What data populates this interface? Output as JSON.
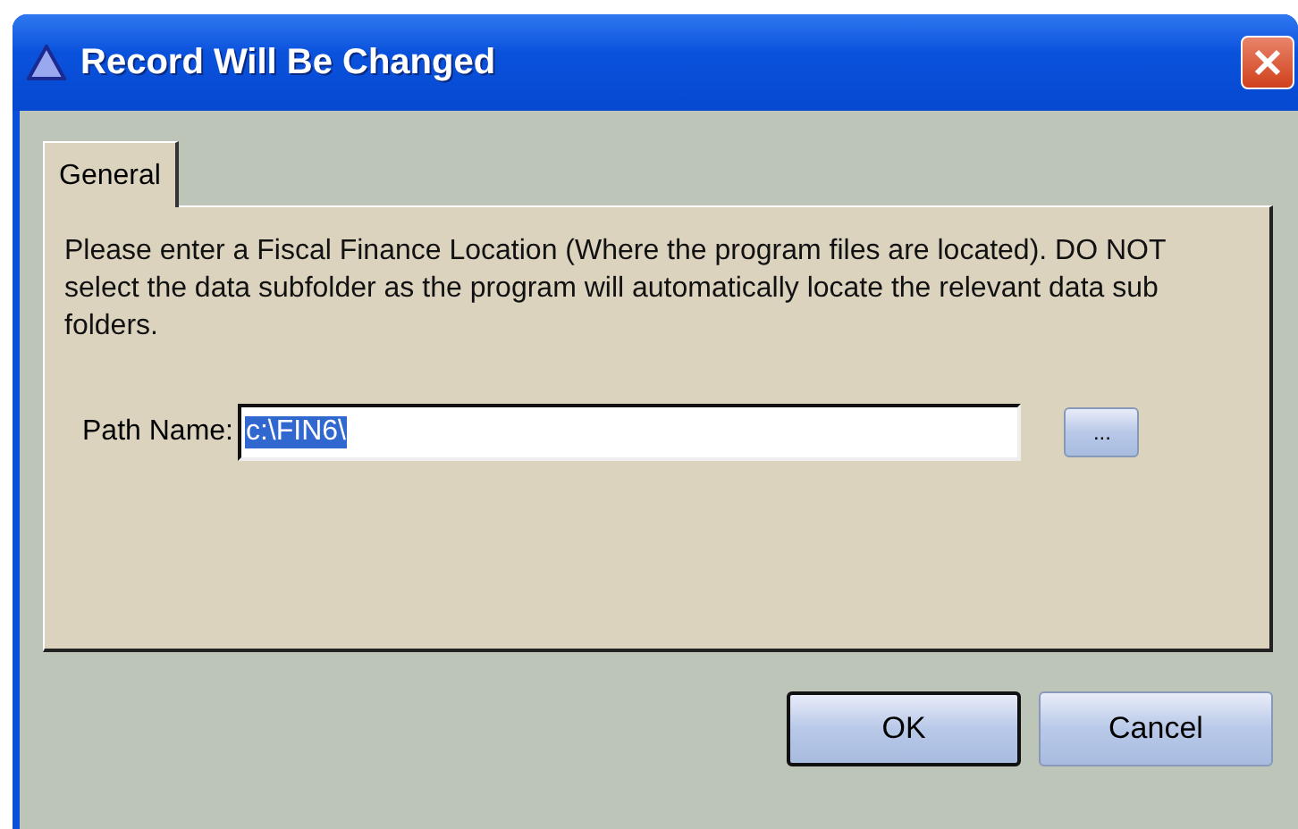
{
  "window": {
    "title": "Record Will Be Changed"
  },
  "tabs": [
    {
      "label": "General",
      "selected": true
    }
  ],
  "message": "Please enter a Fiscal Finance Location (Where the program files are located). DO NOT select the data subfolder as the program will automatically locate the relevant data sub folders.",
  "path": {
    "label": "Path Name:",
    "value": "c:\\FIN6\\",
    "value_selected": true,
    "browse_button": "..."
  },
  "buttons": [
    {
      "label": "OK",
      "default": true
    },
    {
      "label": "Cancel",
      "default": false
    }
  ]
}
